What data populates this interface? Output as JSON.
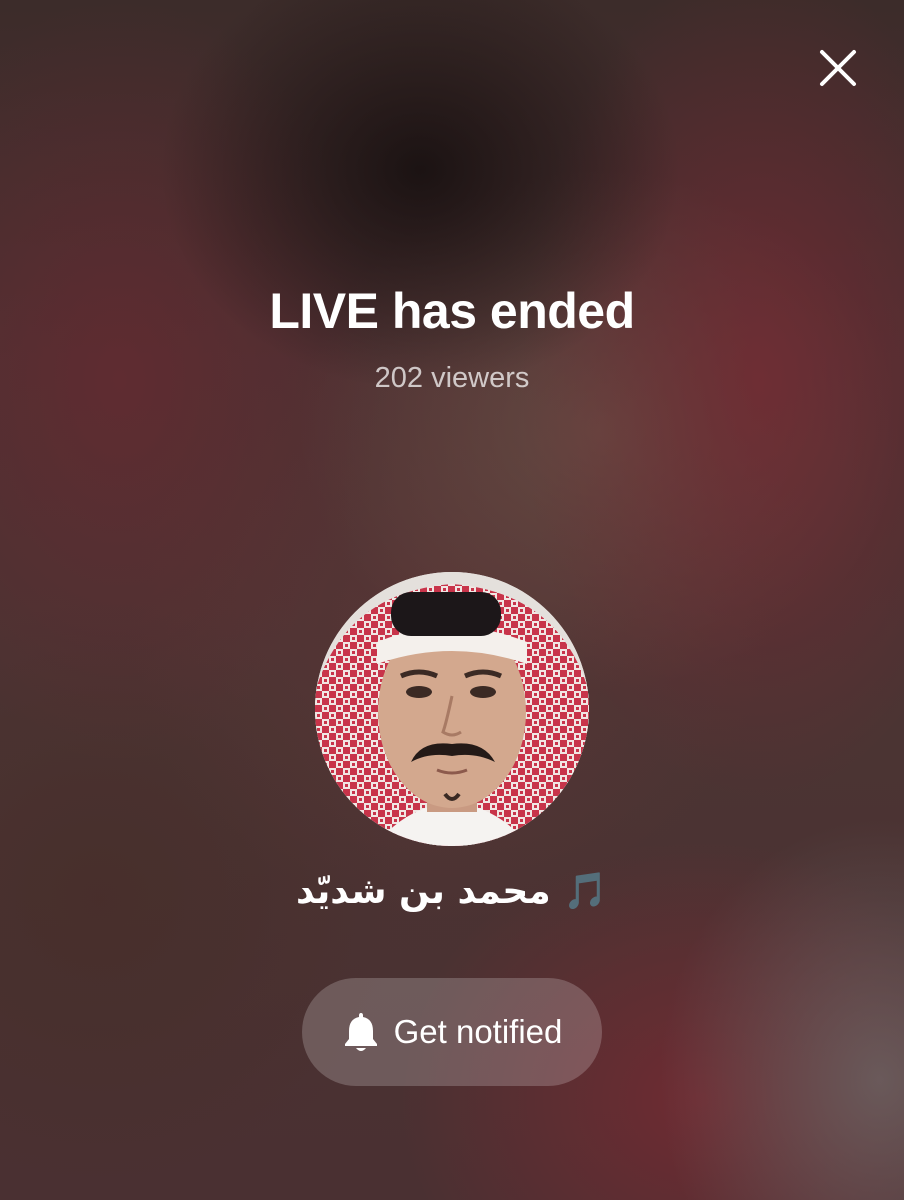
{
  "live_end": {
    "title": "LIVE has ended",
    "viewers": "202 viewers"
  },
  "host": {
    "username": "محمد بن شديّد 🎵",
    "avatar": "profile-photo"
  },
  "actions": {
    "close_icon": "close-icon",
    "notify_icon": "bell-icon",
    "notify_label": "Get notified"
  }
}
